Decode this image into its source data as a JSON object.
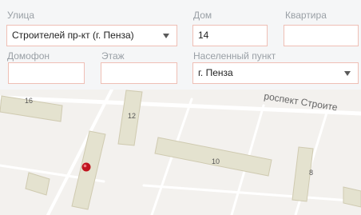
{
  "form": {
    "street": {
      "label": "Улица",
      "value": "Строителей пр-кт (г. Пенза)"
    },
    "house": {
      "label": "Дом",
      "value": "14"
    },
    "apartment": {
      "label": "Квартира",
      "value": ""
    },
    "intercom": {
      "label": "Домофон",
      "value": ""
    },
    "floor": {
      "label": "Этаж",
      "value": ""
    },
    "locality": {
      "label": "Населенный пункт",
      "value": "г. Пенза"
    }
  },
  "map": {
    "street_label": "роспект Строите",
    "buildings": [
      "16",
      "12",
      "10",
      "8"
    ],
    "colors": {
      "background": "#f3f1ee",
      "building": "#e4e2cf",
      "marker": "#c0141e"
    }
  }
}
